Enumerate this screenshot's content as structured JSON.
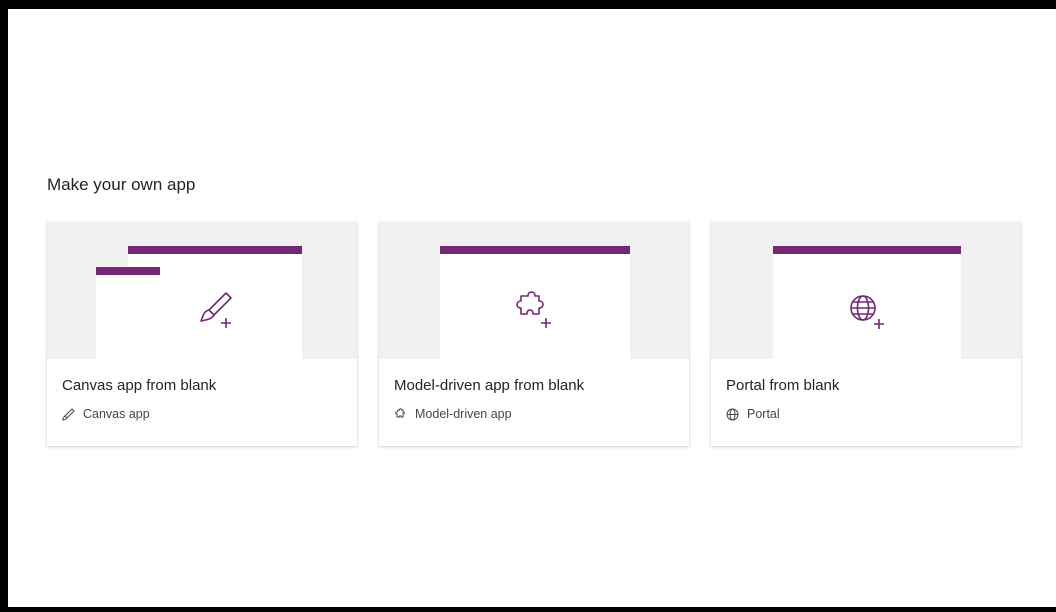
{
  "section": {
    "title": "Make your own app"
  },
  "colors": {
    "accent": "#742774",
    "thumb_bg": "#f1f1f1"
  },
  "cards": [
    {
      "title": "Canvas app from blank",
      "type_label": "Canvas app",
      "icon": "brush-plus-icon"
    },
    {
      "title": "Model-driven app from blank",
      "type_label": "Model-driven app",
      "icon": "puzzle-plus-icon"
    },
    {
      "title": "Portal from blank",
      "type_label": "Portal",
      "icon": "globe-plus-icon"
    }
  ]
}
